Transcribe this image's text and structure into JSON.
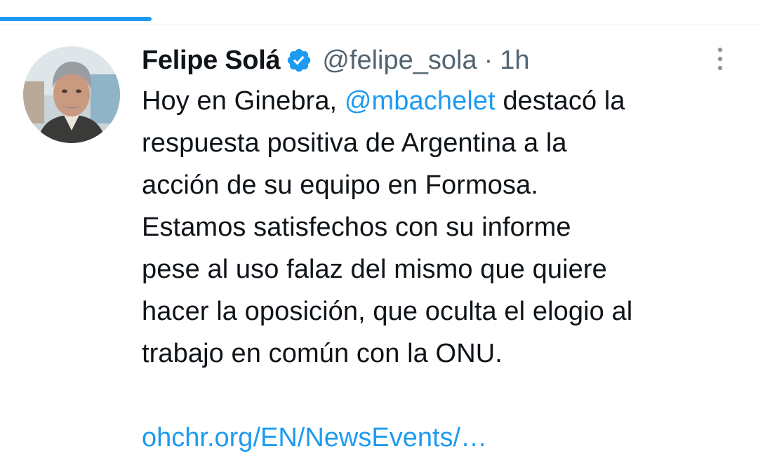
{
  "colors": {
    "accent": "#1d9bf0",
    "secondary_text": "#536471",
    "primary_text": "#0f1419"
  },
  "tweet": {
    "author": {
      "display_name": "Felipe Solá",
      "handle": "@felipe_sola",
      "verified": true,
      "avatar_icon": "user-avatar-photo"
    },
    "separator": "·",
    "timestamp": "1h",
    "text": {
      "line1_before": "Hoy en Ginebra, ",
      "line1_mention": "@mbachelet",
      "line1_after": " destacó la",
      "line2": "respuesta positiva de  Argentina a la",
      "line3": "acción de su equipo en Formosa.",
      "line4": "Estamos satisfechos con su informe",
      "line5": "pese al uso falaz del mismo que quiere",
      "line6": "hacer la oposición, que oculta el elogio al",
      "line7": "trabajo en común con la ONU."
    },
    "link_text": "ohchr.org/EN/NewsEvents/…",
    "more_icon": "more-vertical-icon"
  }
}
